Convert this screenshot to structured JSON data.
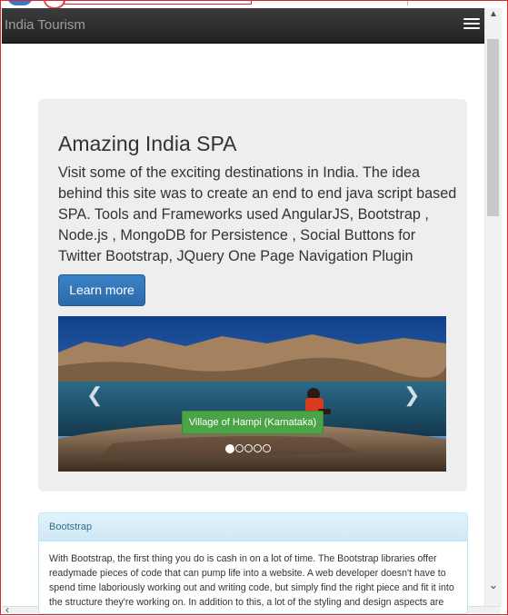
{
  "navbar": {
    "brand": "India Tourism",
    "toggle_icon": "hamburger-icon"
  },
  "jumbotron": {
    "title": "Amazing India SPA",
    "description": "Visit some of the exciting destinations in India. The idea behind this site was to create an end to end java script based SPA. Tools and Frameworks used AngularJS, Bootstrap , Node.js , MongoDB for Persistence , Social Buttons for Twitter Bootstrap, JQuery One Page Navigation Plugin",
    "button_label": "Learn more"
  },
  "carousel": {
    "caption": "Village of Hampi (Karnataka)",
    "slide_count": 5,
    "active_slide": 1,
    "left_icon": "chevron-left-icon",
    "right_icon": "chevron-right-icon"
  },
  "panel": {
    "title": "Bootstrap",
    "body": "With Bootstrap, the first thing you do is cash in on a lot of time. The Bootstrap libraries offer readymade pieces of code that can pump life into a website. A web developer doesn't have to spend time laboriously working out and writing code, but simply find the right piece and fit it into the structure they're working on. In addition to this, a lot of the styling and design aspects are"
  },
  "colors": {
    "navbar_bg": "#222222",
    "button_primary": "#337ab7",
    "caption_bg": "#4aa446",
    "panel_heading": "#d9edf7",
    "panel_title": "#31708f"
  }
}
